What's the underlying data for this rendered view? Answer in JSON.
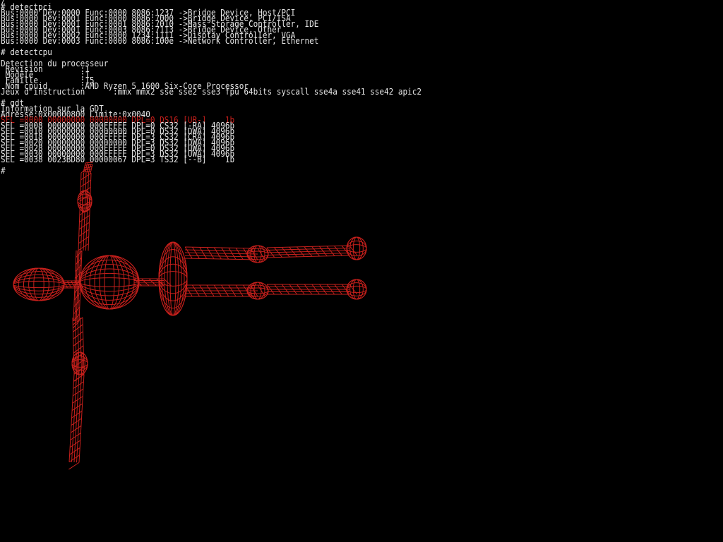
{
  "console": {
    "lines": [
      {
        "text": "/",
        "color": "#e6e6e6"
      },
      {
        "text": "# detectpci",
        "color": "#e6e6e6"
      },
      {
        "text": "Bus:0000 Dev:0000 Func:0000 8086:1237 ->Bridge Device, Host/PCI",
        "color": "#e6e6e6"
      },
      {
        "text": "Bus:0000 Dev:0001 Func:0000 8086:7000 ->Bridge Device, PCI/ISA",
        "color": "#e6e6e6"
      },
      {
        "text": "Bus:0000 Dev:0001 Func:0001 8086:7010 ->Mass Storage Controller, IDE",
        "color": "#e6e6e6"
      },
      {
        "text": "Bus:0000 Dev:0001 Func:0003 8086:7113 ->Bridge Device, Other",
        "color": "#e6e6e6"
      },
      {
        "text": "Bus:0000 Dev:0002 Func:0000 1234:1111 ->Display Controller, VGA",
        "color": "#e6e6e6"
      },
      {
        "text": "Bus:0000 Dev:0003 Func:0000 8086:100e ->Network Controller, Ethernet",
        "color": "#e6e6e6"
      },
      {
        "text": "",
        "color": "#e6e6e6"
      },
      {
        "text": "# detectcpu",
        "color": "#e6e6e6"
      },
      {
        "text": "",
        "color": "#e6e6e6"
      },
      {
        "text": "Detection du processeur",
        "color": "#e6e6e6"
      },
      {
        "text": " Revision        :1",
        "color": "#e6e6e6"
      },
      {
        "text": " Modele          :1",
        "color": "#e6e6e6"
      },
      {
        "text": " Famille         :15",
        "color": "#e6e6e6"
      },
      {
        "text": " Nom cpuid       :AMD Ryzen 5 1600 Six-Core Processor",
        "color": "#e6e6e6"
      },
      {
        "text": "Jeux d'instruction      :mmx mmx2 sse sse2 sse3 fpu 64bits syscall sse4a sse41 sse42 apic2",
        "color": "#e6e6e6"
      },
      {
        "text": "",
        "color": "#e6e6e6"
      },
      {
        "text": "# gdt",
        "color": "#e6e6e6"
      },
      {
        "text": "Information sur la GDT",
        "color": "#e6e6e6"
      },
      {
        "text": "Adresse:0x00000800 Limite:0x0040",
        "color": "#e6e6e6"
      },
      {
        "text": "SEL =0000 00000000 00000000 DPL=0 DS16 [UR-]    1b",
        "color": "#c8201c"
      },
      {
        "text": "SEL =0008 00000000 000FFFFF DPL=0 CS32 [-RA] 4096b",
        "color": "#e6e6e6"
      },
      {
        "text": "SEL =0010 00000000 00000000 DPL=0 DS32 [DWA] 4096b",
        "color": "#e6e6e6"
      },
      {
        "text": "SEL =0018 00000000 000FFFFF DPL=3 CS32 [CRA] 4096b",
        "color": "#e6e6e6"
      },
      {
        "text": "SEL =0020 00000000 00000000 DPL=3 DS32 [DWA] 4096b",
        "color": "#e6e6e6"
      },
      {
        "text": "SEL =0028 00000000 000FFFFF DPL=0 DS32 [UWA] 4096b",
        "color": "#e6e6e6"
      },
      {
        "text": "SEL =0030 00000000 000FFFFF DPL=3 DS32 [UWA] 4096b",
        "color": "#e6e6e6"
      },
      {
        "text": "SEL =0038 0023BD80 00000067 DPL=3 TS32 [--B]    1b",
        "color": "#e6e6e6"
      },
      {
        "text": "",
        "color": "#e6e6e6"
      },
      {
        "text": "#",
        "color": "#e6e6e6"
      }
    ]
  },
  "wireframe": {
    "subject": "skeleton-3d-wireframe",
    "color": "#c8201c"
  }
}
